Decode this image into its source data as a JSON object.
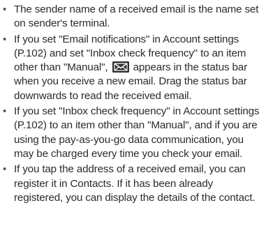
{
  "notes": [
    {
      "text": "The sender name of a received email is the name set on sender's terminal."
    },
    {
      "text_before_icon": "If you set \"Email notifications\" in Account settings (P.102) and set \"Inbox check frequency\" to an item other than \"Manual\",",
      "icon": "new-email-status-icon",
      "text_after_icon": "appears in the status bar when you receive a new email. Drag the status bar downwards to read the received email."
    },
    {
      "text": "If you set \"Inbox check frequency\" in Account settings (P.102) to an item other than \"Manual\", and if you are using the pay-as-you-go data communication, you may be charged every time you check your email."
    },
    {
      "text": "If you tap the address of a received email, you can register it in Contacts. If it has been already registered, you can display the details of the contact."
    }
  ],
  "bullet_glyph": "•"
}
